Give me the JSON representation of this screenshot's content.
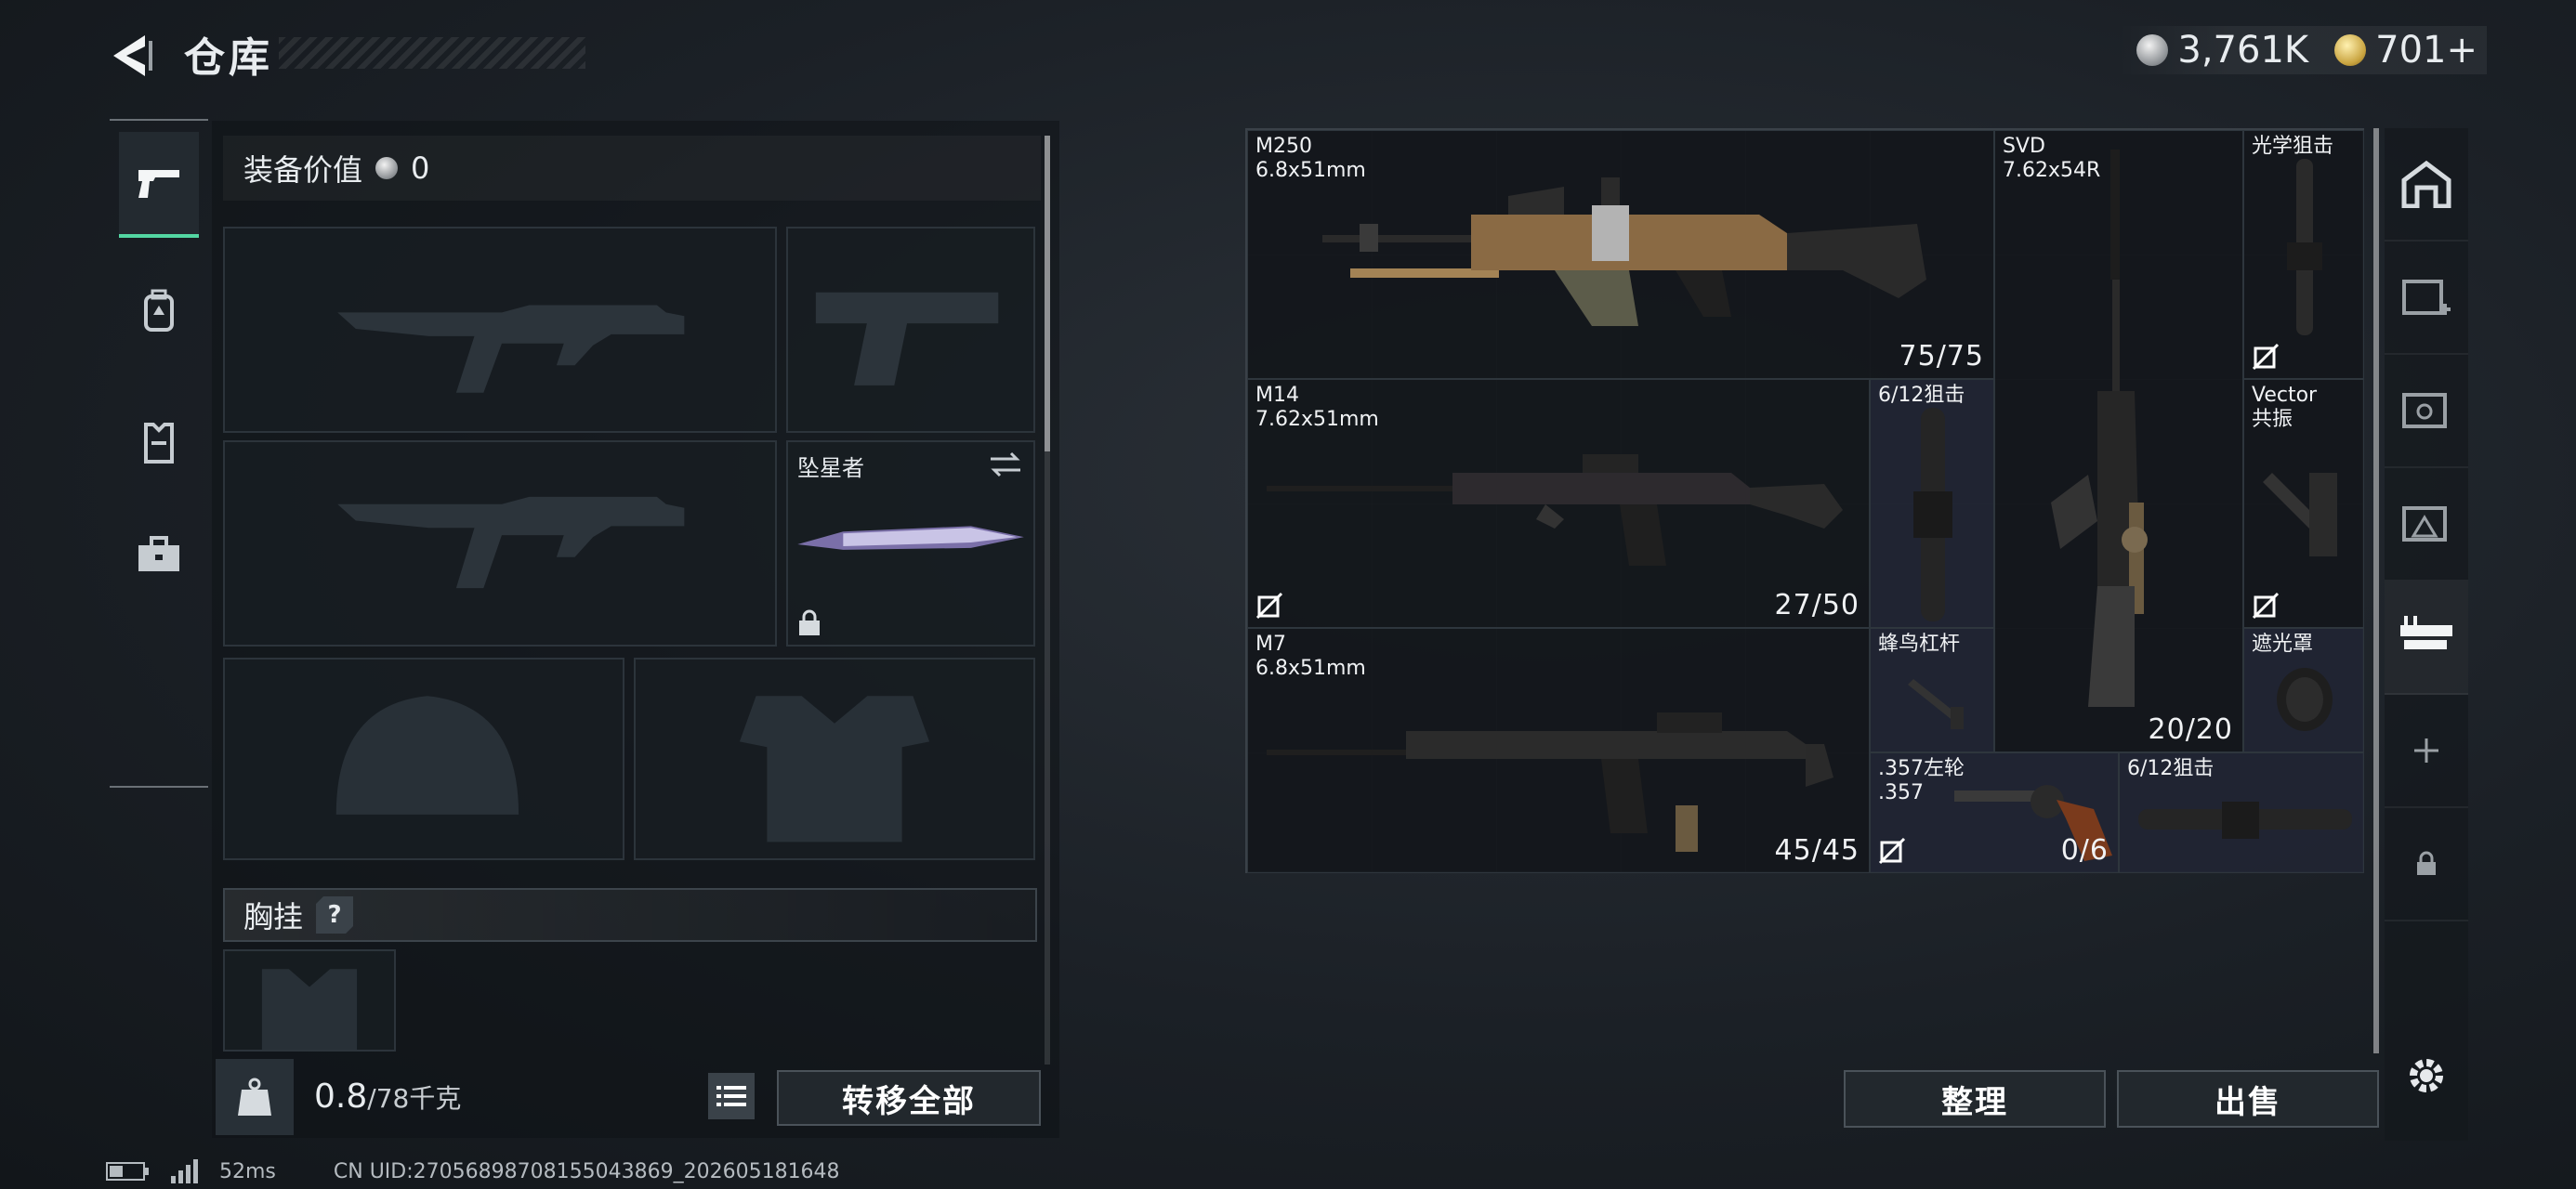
{
  "header": {
    "title": "仓库",
    "currencies": [
      {
        "icon": "silver-coin-icon",
        "value": "3,761K"
      },
      {
        "icon": "gold-coin-icon",
        "value": "701+"
      }
    ]
  },
  "left_rail": {
    "items": [
      {
        "name": "weapons-tab",
        "icon": "pistol-icon",
        "active": true
      },
      {
        "name": "backpack-tab",
        "icon": "backpack-icon",
        "active": false
      },
      {
        "name": "vest-tab",
        "icon": "vest-icon",
        "active": false
      },
      {
        "name": "medkit-tab",
        "icon": "briefcase-icon",
        "active": false
      }
    ]
  },
  "equipment": {
    "value_label": "装备价值",
    "value": "0",
    "melee_label": "坠星者",
    "chest_label": "胸挂",
    "chest_help": "?",
    "weight_current": "0.8",
    "weight_capacity": "/78千克",
    "transfer_all": "转移全部"
  },
  "stash": {
    "items": [
      {
        "name": "M250\n6.8x51mm",
        "count": "75/75"
      },
      {
        "name": "SVD\n7.62x54R",
        "count": "20/20"
      },
      {
        "name": "光学狙击",
        "count": ""
      },
      {
        "name": "M14\n7.62x51mm",
        "count": "27/50"
      },
      {
        "name": "6/12狙击",
        "count": ""
      },
      {
        "name": "Vector\n共振",
        "count": ""
      },
      {
        "name": "M7\n6.8x51mm",
        "count": "45/45"
      },
      {
        "name": "蜂鸟杠杆",
        "count": ""
      },
      {
        "name": "遮光罩",
        "count": ""
      },
      {
        "name": ".357左轮\n.357",
        "count": "0/6"
      },
      {
        "name": "6/12狙击",
        "count": ""
      }
    ],
    "sort_button": "整理",
    "sell_button": "出售"
  },
  "status": {
    "ping": "52ms",
    "uid": "CN UID:270568987081550438​69_202605181648"
  },
  "colors": {
    "accent": "#53d6a2",
    "background": "#1b2026"
  }
}
